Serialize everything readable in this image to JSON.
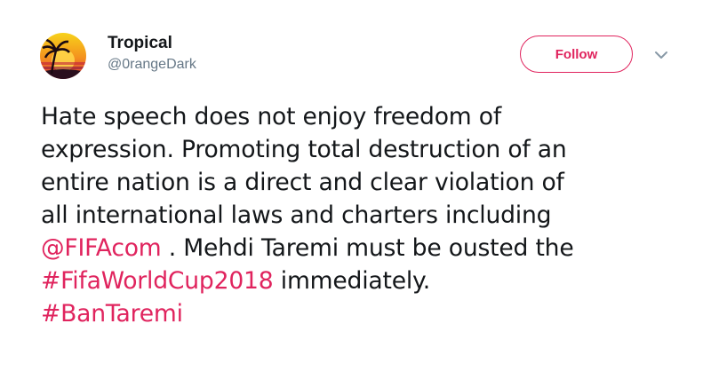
{
  "user": {
    "display_name": "Tropical",
    "handle": "@0rangeDark"
  },
  "actions": {
    "follow_label": "Follow",
    "more_icon": "chevron-down-icon"
  },
  "tweet": {
    "lines": [
      "Hate speech does not enjoy freedom of",
      "expression. Promoting total destruction of an",
      "entire nation is a direct and clear violation of",
      "all international laws and charters including"
    ],
    "mention": "@FIFAcom",
    "after_mention": " . Mehdi Taremi must be ousted the",
    "hashtag1": "#FifaWorldCup2018",
    "after_hashtag1": " immediately.",
    "hashtag2": "#BanTaremi"
  },
  "colors": {
    "accent": "#e0245e",
    "text": "#14171a",
    "muted": "#657786"
  }
}
